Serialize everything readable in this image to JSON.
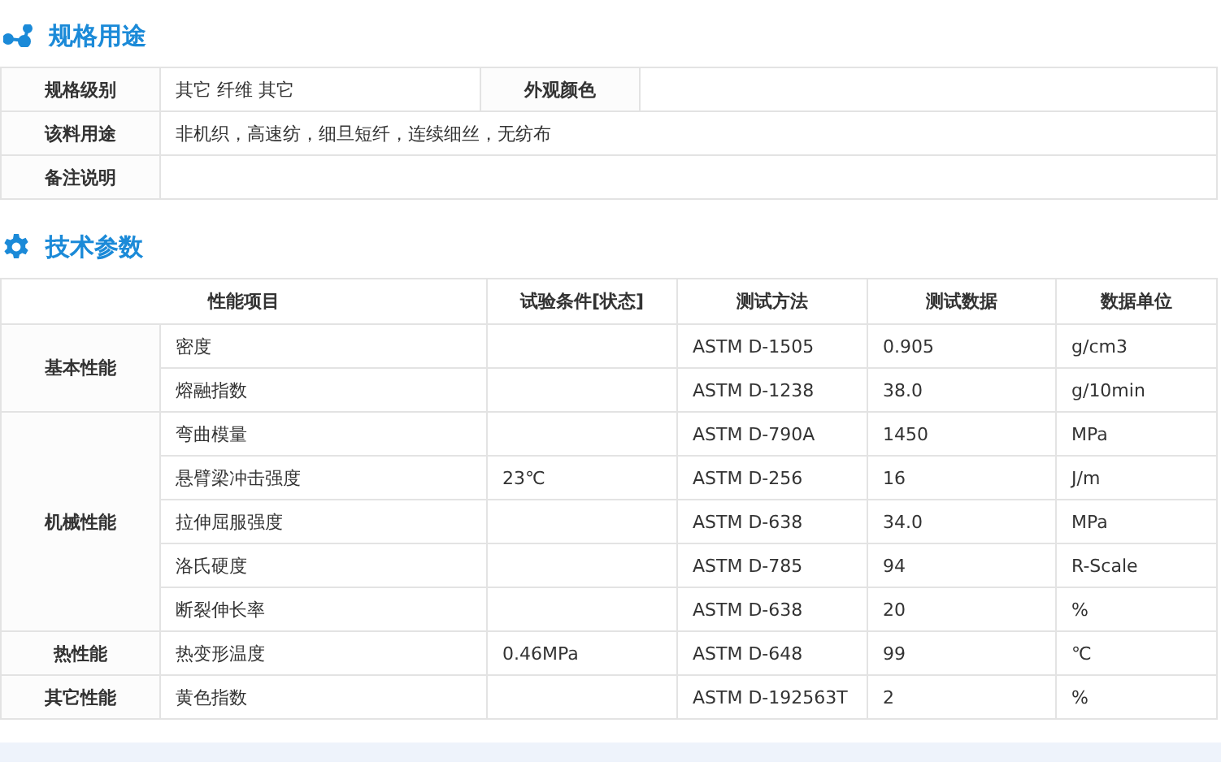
{
  "spec_section": {
    "title": "规格用途"
  },
  "spec_table": {
    "rows": [
      {
        "label": "规格级别",
        "value": "其它 纤维 其它",
        "label_2": "外观颜色"
      },
      {
        "label": "该料用途",
        "value": "非机织，高速纺，细旦短纤，连续细丝，无纺布"
      },
      {
        "label": "备注说明"
      }
    ]
  },
  "tech_section": {
    "title": "技术参数"
  },
  "tech_table": {
    "columns": [
      "性能项目",
      "试验条件[状态]",
      "测试方法",
      "测试数据",
      "数据单位"
    ],
    "groups": [
      {
        "name": "基本性能",
        "rows": [
          {
            "property": "密度",
            "method": "ASTM D-1505",
            "value": "0.905",
            "unit": "g/cm3"
          },
          {
            "property": "熔融指数",
            "method": "ASTM D-1238",
            "value": "38.0",
            "unit": "g/10min"
          }
        ]
      },
      {
        "name": "机械性能",
        "rows": [
          {
            "property": "弯曲模量",
            "method": "ASTM D-790A",
            "value": "1450",
            "unit": "MPa"
          },
          {
            "property": "悬臂梁冲击强度",
            "condition": "23℃",
            "method": "ASTM D-256",
            "value": "16",
            "unit": "J/m"
          },
          {
            "property": "拉伸屈服强度",
            "method": "ASTM D-638",
            "value": "34.0",
            "unit": "MPa"
          },
          {
            "property": "洛氏硬度",
            "method": "ASTM D-785",
            "value": "94",
            "unit": "R-Scale"
          },
          {
            "property": "断裂伸长率",
            "method": "ASTM D-638",
            "value": "20",
            "unit": "%"
          }
        ]
      },
      {
        "name": "热性能",
        "rows": [
          {
            "property": "热变形温度",
            "condition": "0.46MPa",
            "method": "ASTM D-648",
            "value": "99",
            "unit": "℃"
          }
        ]
      },
      {
        "name": "其它性能",
        "rows": [
          {
            "property": "黄色指数",
            "method": "ASTM D-192563T",
            "value": "2",
            "unit": "%"
          }
        ]
      }
    ]
  }
}
